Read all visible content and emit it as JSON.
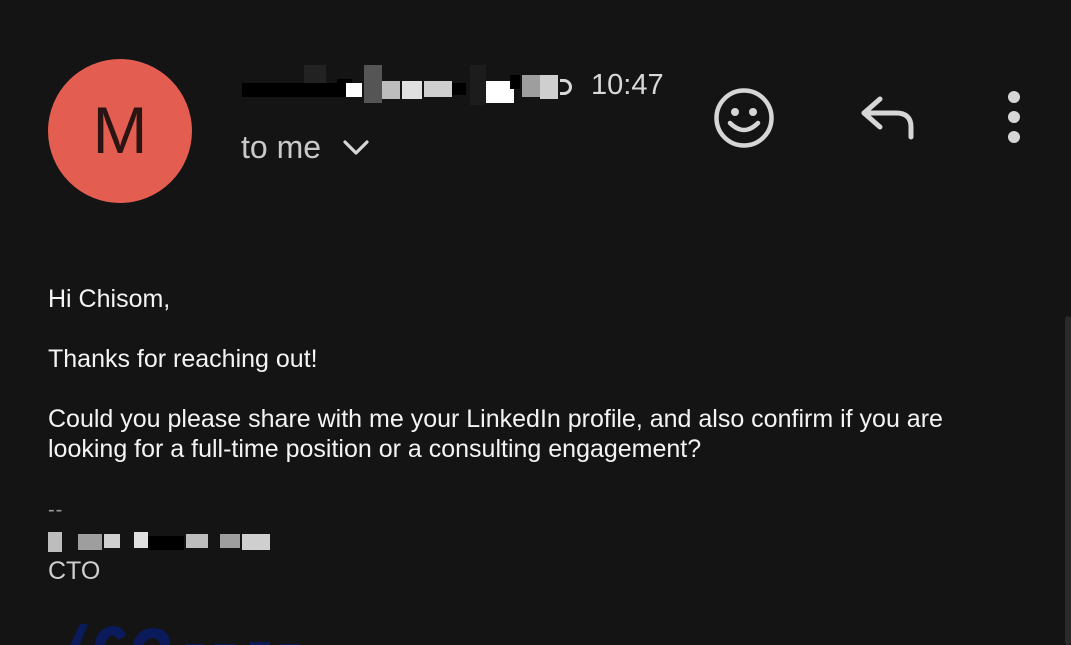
{
  "message": {
    "avatar_letter": "M",
    "avatar_color": "#e35d51",
    "sender_name": "",
    "time": "10:47",
    "recipient_label": "to me"
  },
  "actions": {
    "emoji_icon": "emoji-smile-icon",
    "reply_icon": "reply-arrow-icon",
    "more_icon": "more-vertical-icon"
  },
  "body": {
    "greeting": "Hi Chisom,",
    "thanks": "Thanks for reaching out!",
    "question": "Could you please share with me your LinkedIn profile, and also confirm if you are looking for a full-time position or a consulting engagement?"
  },
  "signature": {
    "separator": "--",
    "name": "",
    "title": "CTO"
  },
  "colors": {
    "background": "#141414",
    "text": "#f4f4f4",
    "icon": "#d6d6d6"
  }
}
